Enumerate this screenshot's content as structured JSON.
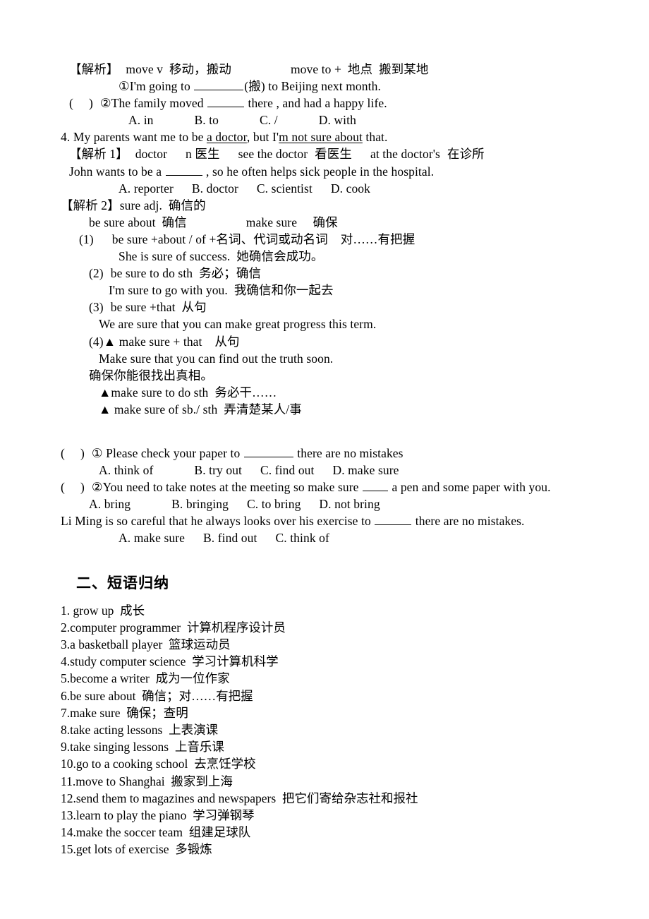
{
  "document": {
    "section1": {
      "explain_move": {
        "tag": "【解析】",
        "body": "move v  移动，搬动",
        "extra": "move to +  地点  搬到某地"
      },
      "q_move_1": {
        "marker": "①",
        "text_before": "I'm going to ",
        "text_after": "(搬) to Beijing next month."
      },
      "q_move_2": {
        "paren_open": "(",
        "paren_close": ")",
        "marker": "②",
        "text_before": "The family moved ",
        "text_after": " there , and had a happy life.",
        "options": [
          "A. in",
          "B. to",
          "C. /",
          "D. with"
        ]
      },
      "item4": {
        "number": "4. ",
        "p1": "My parents want me to be ",
        "u1": "a doctor",
        "p2": ", but I'",
        "u2": "m not sure about",
        "p3": " that."
      },
      "explain_doctor": {
        "tag": "【解析 1】",
        "word": "doctor",
        "pos": "n 医生",
        "phrase1": "see the doctor",
        "meaning1": "看医生",
        "phrase2": "at the doctor's",
        "meaning2": "在诊所"
      },
      "q_doctor": {
        "text_before": "John wants to be a ",
        "text_after": " , so he often helps sick people in the hospital.",
        "options": [
          "A. reporter",
          "B. doctor",
          "C. scientist",
          "D. cook"
        ]
      },
      "explain_sure": {
        "tag": "【解析 2】",
        "body": "sure adj.  确信的"
      },
      "sure_line": {
        "left": "be sure about  确信",
        "right": "make sure     确保"
      },
      "rules": [
        {
          "num": "(1)",
          "text": "be sure +about / of +名词、代词或动名词    对……有把握",
          "example": "She is sure of success.  她确信会成功。"
        },
        {
          "num": "(2)",
          "text": "be sure to do sth  务必；确信",
          "example": "I'm sure to go with you.  我确信和你一起去"
        },
        {
          "num": "(3)",
          "text": "be sure +that  从句",
          "example": "We are sure that you can make great progress this term."
        },
        {
          "num": "(4)",
          "marker": "▲",
          "text": " make sure + that    从句",
          "example": "Make sure that you can find out the truth soon.",
          "example_cn": "确保你能很找出真相。"
        }
      ],
      "triangles": [
        {
          "marker": "▲",
          "text": "make sure to do sth  务必干……"
        },
        {
          "marker": "▲",
          "text": " make sure of sb./ sth  弄清楚某人/事"
        }
      ],
      "exercises": [
        {
          "paren_open": "(",
          "paren_close": ")",
          "marker": "①",
          "text_before": " Please check your paper to ",
          "text_after": " there are no mistakes",
          "options": [
            "A. think of",
            "B. try out",
            "C. find out",
            "D. make sure"
          ]
        },
        {
          "paren_open": "(",
          "paren_close": ")",
          "marker": "②",
          "text_before": "You need to take notes at the meeting so make sure ",
          "text_after": " a pen and some paper with you.",
          "options": [
            "A. bring",
            "B. bringing",
            "C. to bring",
            "D. not bring"
          ]
        }
      ],
      "final_question": {
        "text_before": "Li Ming is so careful that he always looks over his exercise to ",
        "text_after": " there are no mistakes.",
        "options": [
          "A. make sure",
          "B. find out",
          "C. think of"
        ]
      }
    },
    "section2": {
      "heading": "二、短语归纳",
      "phrases": [
        "1. grow up  成长",
        "2.computer programmer  计算机程序设计员",
        "3.a basketball player  篮球运动员",
        "4.study computer science  学习计算机科学",
        "5.become a writer  成为一位作家",
        "6.be sure about  确信；对……有把握",
        "7.make sure  确保；查明",
        "8.take acting lessons  上表演课",
        "9.take singing lessons  上音乐课",
        "10.go to a cooking school  去烹饪学校",
        "11.move to Shanghai  搬家到上海",
        "12.send them to magazines and newspapers  把它们寄给杂志社和报社",
        "13.learn to play the piano  学习弹钢琴",
        "14.make the soccer team  组建足球队",
        "15.get lots of exercise  多锻炼"
      ]
    }
  }
}
